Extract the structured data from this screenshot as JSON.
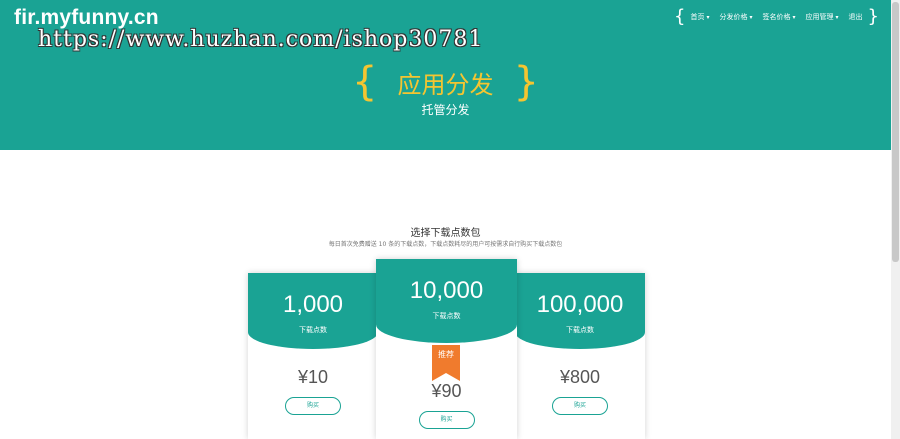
{
  "header": {
    "logo": "fir.myfunny.cn",
    "watermark": "https://www.huzhan.com/ishop30781",
    "nav": {
      "open_brace": "{",
      "close_brace": "}",
      "items": [
        {
          "label": "首页"
        },
        {
          "label": "分发价格"
        },
        {
          "label": "签名价格"
        },
        {
          "label": "应用管理"
        },
        {
          "label": "退出"
        }
      ]
    },
    "hero_title": "应用分发",
    "hero_subtitle": "托管分发"
  },
  "section": {
    "title": "选择下载点数包",
    "description": "每日首次免费赠送 10 条的下载点数，下载点数耗尽的用户可按需求自行购买下载点数包"
  },
  "plans": [
    {
      "amount": "1,000",
      "unit": "下载点数",
      "price": "¥10",
      "buy_label": "购买",
      "badge": ""
    },
    {
      "amount": "10,000",
      "unit": "下载点数",
      "price": "¥90",
      "buy_label": "购买",
      "badge": "推荐"
    },
    {
      "amount": "100,000",
      "unit": "下载点数",
      "price": "¥800",
      "buy_label": "购买",
      "badge": ""
    }
  ],
  "colors": {
    "brand": "#1aa394",
    "accent": "#f4c531",
    "badge": "#f07b2d"
  }
}
